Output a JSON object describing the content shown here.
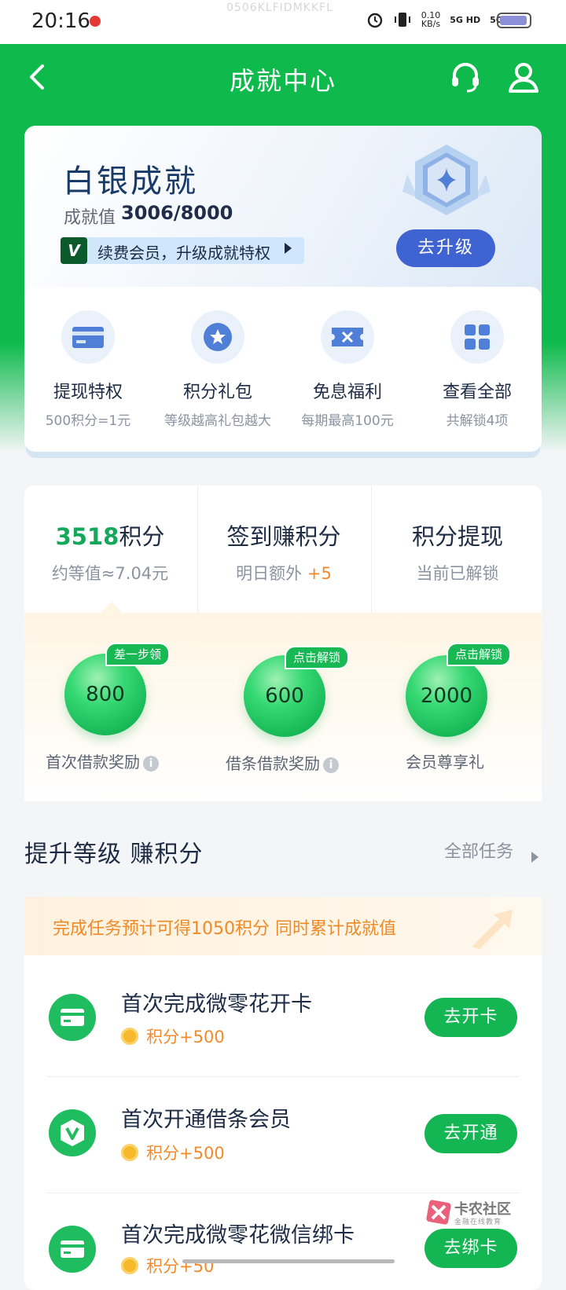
{
  "status_bar": {
    "time": "20:16",
    "watermark": "0506KLFIDMKKFL",
    "net_speed": "0.10",
    "net_unit": "KB/s",
    "signal1": "5G HD",
    "signal2": "5G HD"
  },
  "header": {
    "title": "成就中心",
    "back_icon": "chevron-left-icon",
    "service_icon": "headset-icon",
    "profile_icon": "user-icon"
  },
  "achievement": {
    "rank": "白银成就",
    "value_label": "成就值",
    "value": "3006/8000",
    "progress": 0.376,
    "promo_badge": "V",
    "promo_text": "续费会员，升级成就特权",
    "upgrade_button": "去升级"
  },
  "privileges": [
    {
      "title": "提现特权",
      "subtitle": "500积分=1元",
      "icon": "card-icon"
    },
    {
      "title": "积分礼包",
      "subtitle": "等级越高礼包越大",
      "icon": "star-badge-icon"
    },
    {
      "title": "免息福利",
      "subtitle": "每期最高100元",
      "icon": "ticket-icon"
    },
    {
      "title": "查看全部",
      "subtitle": "共解锁4项",
      "icon": "grid-icon"
    }
  ],
  "points": {
    "amount": "3518",
    "unit": "积分",
    "equivalent": "约等值≈7.04元",
    "checkin_title": "签到赚积分",
    "checkin_sub": "明日额外",
    "checkin_bonus": "+5",
    "withdraw_title": "积分提现",
    "withdraw_sub": "当前已解锁"
  },
  "bubbles": [
    {
      "value": "800",
      "tag": "差一步领",
      "label": "首次借款奖励",
      "info": "i"
    },
    {
      "value": "600",
      "tag": "点击解锁",
      "label": "借条借款奖励",
      "info": "i"
    },
    {
      "value": "2000",
      "tag": "点击解锁",
      "label": "会员尊享礼"
    }
  ],
  "section": {
    "title": "提升等级 赚积分",
    "more": "全部任务"
  },
  "task_banner": "完成任务预计可得1050积分 同时累计成就值",
  "tasks": [
    {
      "name": "首次完成微零花开卡",
      "reward": "积分+500",
      "button": "去开卡",
      "icon": "card-icon"
    },
    {
      "name": "首次开通借条会员",
      "reward": "积分+500",
      "button": "去开通",
      "icon": "vip-shield-icon"
    },
    {
      "name": "首次完成微零花微信绑卡",
      "reward": "积分+50",
      "button": "去绑卡",
      "icon": "card-icon"
    }
  ],
  "watermark_logo": {
    "name": "卡农社区",
    "slogan": "金融在线教育"
  }
}
